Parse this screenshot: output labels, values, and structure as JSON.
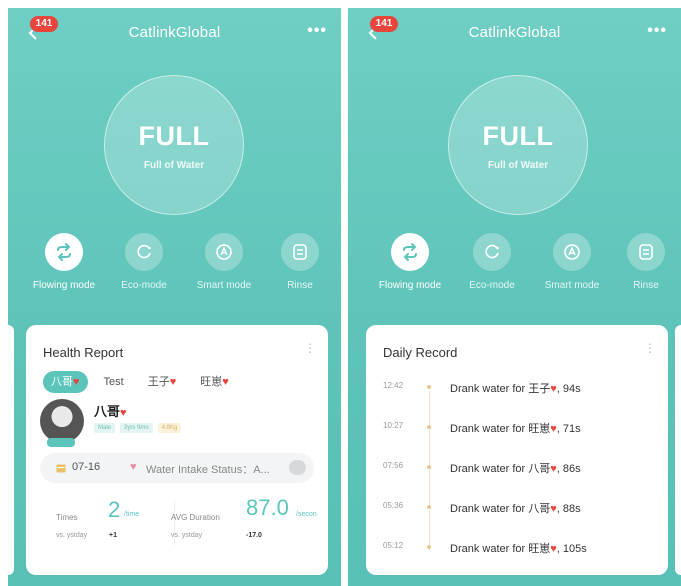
{
  "left": {
    "badge": "141",
    "app_title": "CatlinkGlobal",
    "more": "•••",
    "status_main": "FULL",
    "status_sub": "Full of Water",
    "modes": [
      {
        "label": "Flowing mode",
        "icon": "flow-icon",
        "active": true
      },
      {
        "label": "Eco-mode",
        "icon": "eco-icon",
        "active": false
      },
      {
        "label": "Smart mode",
        "icon": "smart-icon",
        "active": false
      },
      {
        "label": "Rinse",
        "icon": "rinse-icon",
        "active": false
      }
    ],
    "card": {
      "title": "Health Report",
      "menu": "⋮",
      "tabs": [
        {
          "label": "八哥",
          "heart": "♥",
          "active": true
        },
        {
          "label": "Test",
          "heart": "",
          "active": false
        },
        {
          "label": "王子",
          "heart": "♥",
          "active": false
        },
        {
          "label": "旺崽",
          "heart": "♥",
          "active": false
        }
      ],
      "pet_name": "八哥",
      "pet_heart": "♥",
      "tags": [
        "Male",
        "3yrs 9mo",
        "4.8Kg"
      ],
      "date": "07-16",
      "intake_status": "Water Intake Status：A...",
      "times_label": "Times",
      "times_value": "2",
      "times_unit": "/time",
      "times_cmp_label": "vs. ystday",
      "times_delta": "+1",
      "avg_label": "AVG Duration",
      "avg_value": "87.0",
      "avg_unit": "/secon",
      "avg_cmp_label": "vs. ystday",
      "avg_delta": "-17.0"
    }
  },
  "right": {
    "badge": "141",
    "app_title": "CatlinkGlobal",
    "more": "•••",
    "status_main": "FULL",
    "status_sub": "Full of Water",
    "modes": [
      {
        "label": "Flowing mode",
        "icon": "flow-icon",
        "active": true
      },
      {
        "label": "Eco-mode",
        "icon": "eco-icon",
        "active": false
      },
      {
        "label": "Smart mode",
        "icon": "smart-icon",
        "active": false
      },
      {
        "label": "Rinse",
        "icon": "rinse-icon",
        "active": false
      }
    ],
    "card": {
      "title": "Daily Record",
      "menu": "⋮",
      "records": [
        {
          "time": "12:42",
          "text_before": "Drank water for 王子",
          "heart": "♥",
          "text_after": ", 94s"
        },
        {
          "time": "10:27",
          "text_before": "Drank water for 旺崽",
          "heart": "♥",
          "text_after": ", 71s"
        },
        {
          "time": "07:56",
          "text_before": "Drank water for 八哥",
          "heart": "♥",
          "text_after": ", 86s"
        },
        {
          "time": "05:36",
          "text_before": "Drank water for 八哥",
          "heart": "♥",
          "text_after": ", 88s"
        },
        {
          "time": "05:12",
          "text_before": "Drank water for 旺崽",
          "heart": "♥",
          "text_after": ", 105s"
        }
      ]
    }
  },
  "colors": {
    "teal_bg": "#5ec4ba",
    "accent": "#5cc5bb",
    "badge_red": "#e8453c",
    "heart_red": "#e8453c"
  }
}
